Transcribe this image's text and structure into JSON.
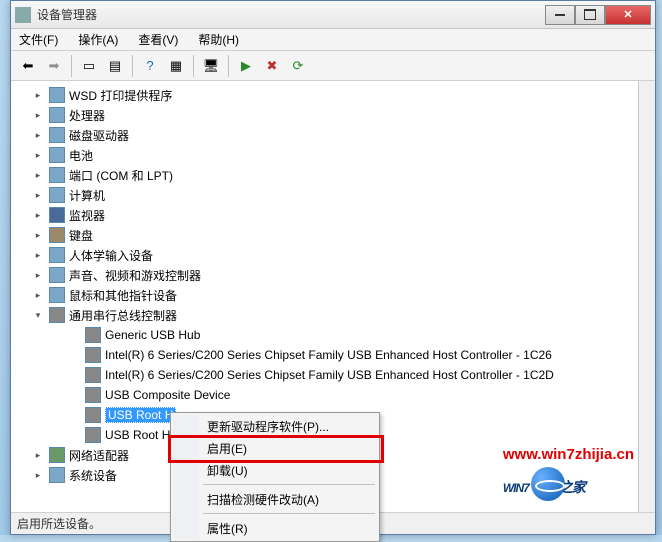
{
  "window": {
    "title": "设备管理器"
  },
  "menubar": {
    "file": "文件(F)",
    "action": "操作(A)",
    "view": "查看(V)",
    "help": "帮助(H)"
  },
  "tree": {
    "items": [
      {
        "level": 1,
        "exp": "plus",
        "icon": "device",
        "label": "WSD 打印提供程序"
      },
      {
        "level": 1,
        "exp": "plus",
        "icon": "device",
        "label": "处理器"
      },
      {
        "level": 1,
        "exp": "plus",
        "icon": "device",
        "label": "磁盘驱动器"
      },
      {
        "level": 1,
        "exp": "plus",
        "icon": "device",
        "label": "电池"
      },
      {
        "level": 1,
        "exp": "plus",
        "icon": "device",
        "label": "端口 (COM 和 LPT)"
      },
      {
        "level": 1,
        "exp": "plus",
        "icon": "device",
        "label": "计算机"
      },
      {
        "level": 1,
        "exp": "plus",
        "icon": "disp",
        "label": "监视器"
      },
      {
        "level": 1,
        "exp": "plus",
        "icon": "kbd",
        "label": "键盘"
      },
      {
        "level": 1,
        "exp": "plus",
        "icon": "device",
        "label": "人体学输入设备"
      },
      {
        "level": 1,
        "exp": "plus",
        "icon": "device",
        "label": "声音、视频和游戏控制器"
      },
      {
        "level": 1,
        "exp": "plus",
        "icon": "device",
        "label": "鼠标和其他指针设备"
      },
      {
        "level": 1,
        "exp": "minus",
        "icon": "usb",
        "label": "通用串行总线控制器"
      },
      {
        "level": 2,
        "exp": "none",
        "icon": "usb",
        "label": "Generic USB Hub"
      },
      {
        "level": 2,
        "exp": "none",
        "icon": "usb",
        "label": "Intel(R) 6 Series/C200 Series Chipset Family USB Enhanced Host Controller - 1C26"
      },
      {
        "level": 2,
        "exp": "none",
        "icon": "usb",
        "label": "Intel(R) 6 Series/C200 Series Chipset Family USB Enhanced Host Controller - 1C2D"
      },
      {
        "level": 2,
        "exp": "none",
        "icon": "usb",
        "label": "USB Composite Device"
      },
      {
        "level": 2,
        "exp": "none",
        "icon": "usb",
        "label": "USB Root H",
        "selected": true
      },
      {
        "level": 2,
        "exp": "none",
        "icon": "usb",
        "label": "USB Root H"
      },
      {
        "level": 1,
        "exp": "plus",
        "icon": "net",
        "label": "网络适配器"
      },
      {
        "level": 1,
        "exp": "plus",
        "icon": "device",
        "label": "系统设备"
      }
    ]
  },
  "context_menu": {
    "update": "更新驱动程序软件(P)...",
    "enable": "启用(E)",
    "uninstall": "卸载(U)",
    "scan": "扫描检测硬件改动(A)",
    "props": "属性(R)"
  },
  "statusbar": {
    "text": "启用所选设备。"
  },
  "watermark": {
    "url": "www.win7zhijia.cn",
    "logo_main": "WIN7",
    "logo_sub": "之家"
  }
}
